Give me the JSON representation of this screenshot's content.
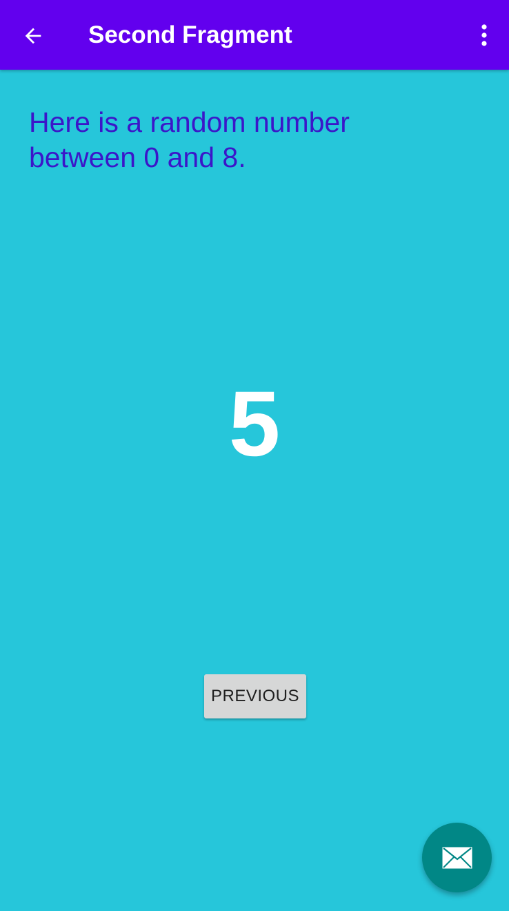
{
  "app_bar": {
    "title": "Second Fragment",
    "background_color": "#6200EE",
    "nav_icon": "arrow-back-icon",
    "menu_icon": "more-vert-icon"
  },
  "content": {
    "intro_text": "Here is a random number between 0 and 8.",
    "random_number": "5",
    "background_color": "#26C6DA",
    "intro_text_color": "#3B16C9"
  },
  "previous_button": {
    "label": "PREVIOUS"
  },
  "fab": {
    "icon": "email-icon",
    "background_color": "#018786"
  }
}
